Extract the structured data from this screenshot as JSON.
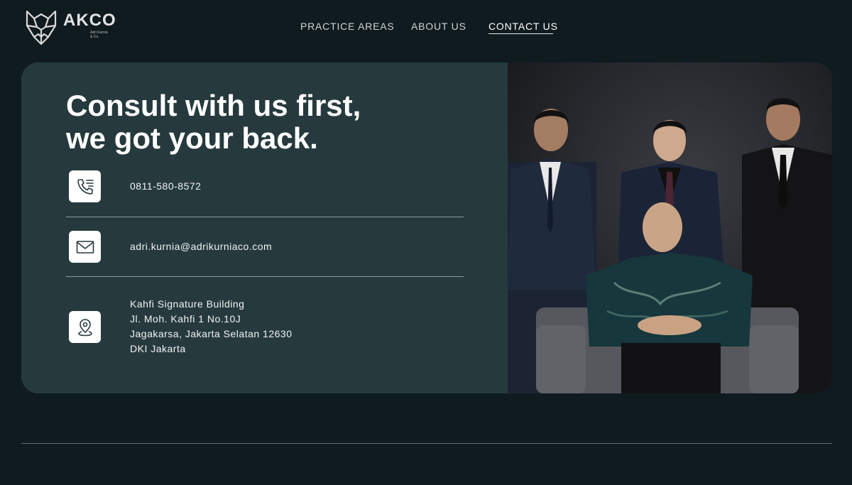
{
  "brand": {
    "name": "AKCO",
    "subline": [
      "Adri Kurnia",
      "& Co."
    ]
  },
  "nav": {
    "items": [
      {
        "label": "PRACTICE AREAS",
        "active": false
      },
      {
        "label": "ABOUT US",
        "active": false
      },
      {
        "label": "CONTACT US",
        "active": true
      }
    ]
  },
  "hero": {
    "headline_lines": [
      "Consult with us first,",
      "we got your back."
    ]
  },
  "contact": {
    "phone": "0811-580-8572",
    "email": "adri.kurnia@adrikurniaco.com",
    "address_lines": [
      "Kahfi Signature Building",
      "Jl. Moh. Kahfi 1 No.10J",
      "Jagakarsa, Jakarta Selatan 12630",
      "DKI Jakarta"
    ]
  },
  "icons": {
    "logo": "wolf-logo-icon",
    "phone": "phone-icon",
    "email": "mail-icon",
    "address": "location-pin-icon"
  },
  "colors": {
    "page_bg": "#101b20",
    "card_bg": "#263a3d",
    "text": "#ffffff",
    "icon_box": "#ffffff"
  }
}
